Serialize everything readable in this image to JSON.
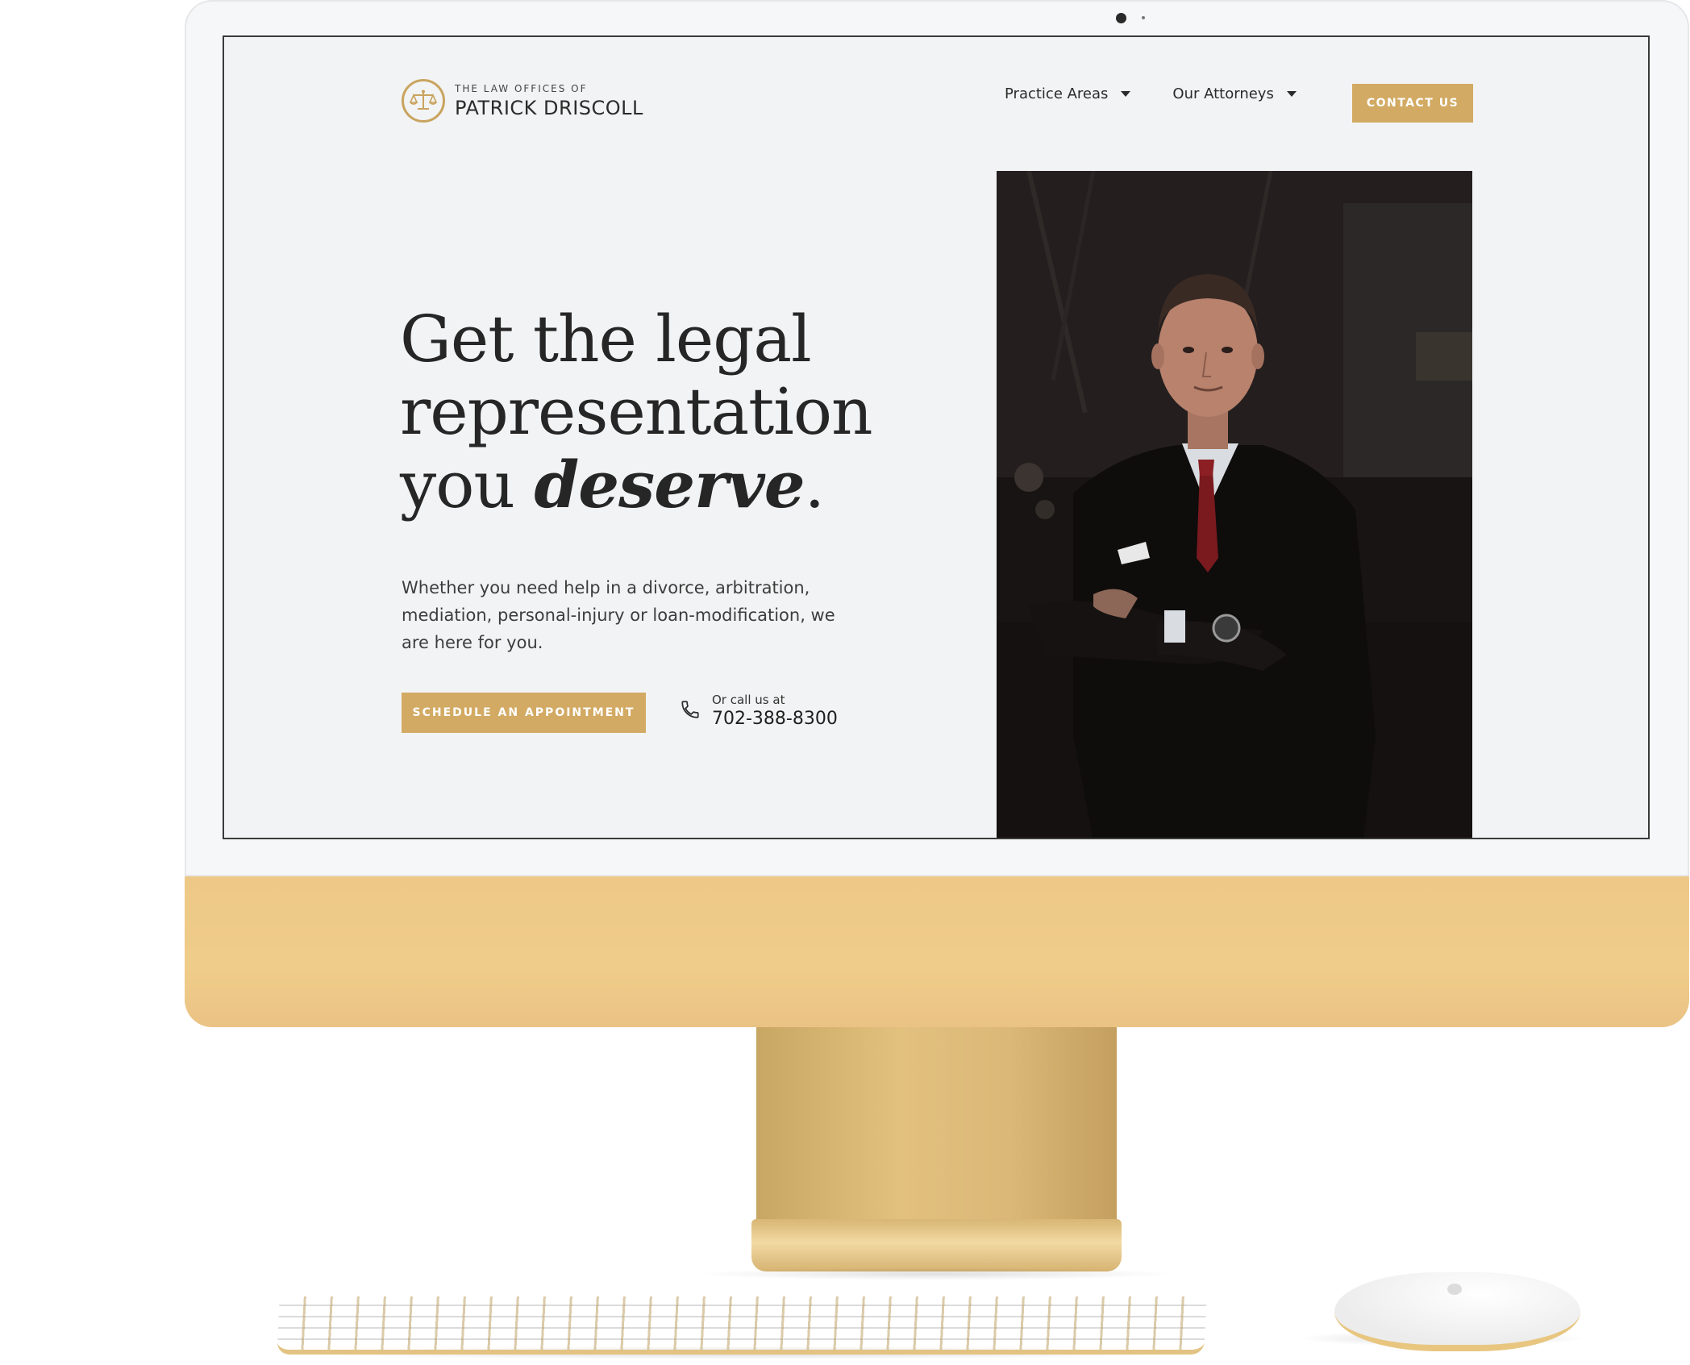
{
  "brand": {
    "subtitle": "THE LAW OFFICES OF",
    "name": "PATRICK DRISCOLL",
    "accent_color": "#d2aa63",
    "icon": "scales-of-justice-icon"
  },
  "nav": {
    "items": [
      {
        "label": "Practice Areas"
      },
      {
        "label": "Our Attorneys"
      }
    ],
    "contact_label": "CONTACT US"
  },
  "hero": {
    "title_line1": "Get the legal",
    "title_line2": "representation",
    "title_line3_prefix": "you ",
    "title_emphasis": "deserve",
    "title_suffix": ".",
    "body": "Whether you need help in a divorce, arbitration, mediation, personal-injury or loan-modification, we are here for you.",
    "cta_label": "SCHEDULE AN APPOINTMENT",
    "call_label": "Or call us at",
    "phone": "702-388-8300",
    "phone_icon": "phone-icon"
  }
}
